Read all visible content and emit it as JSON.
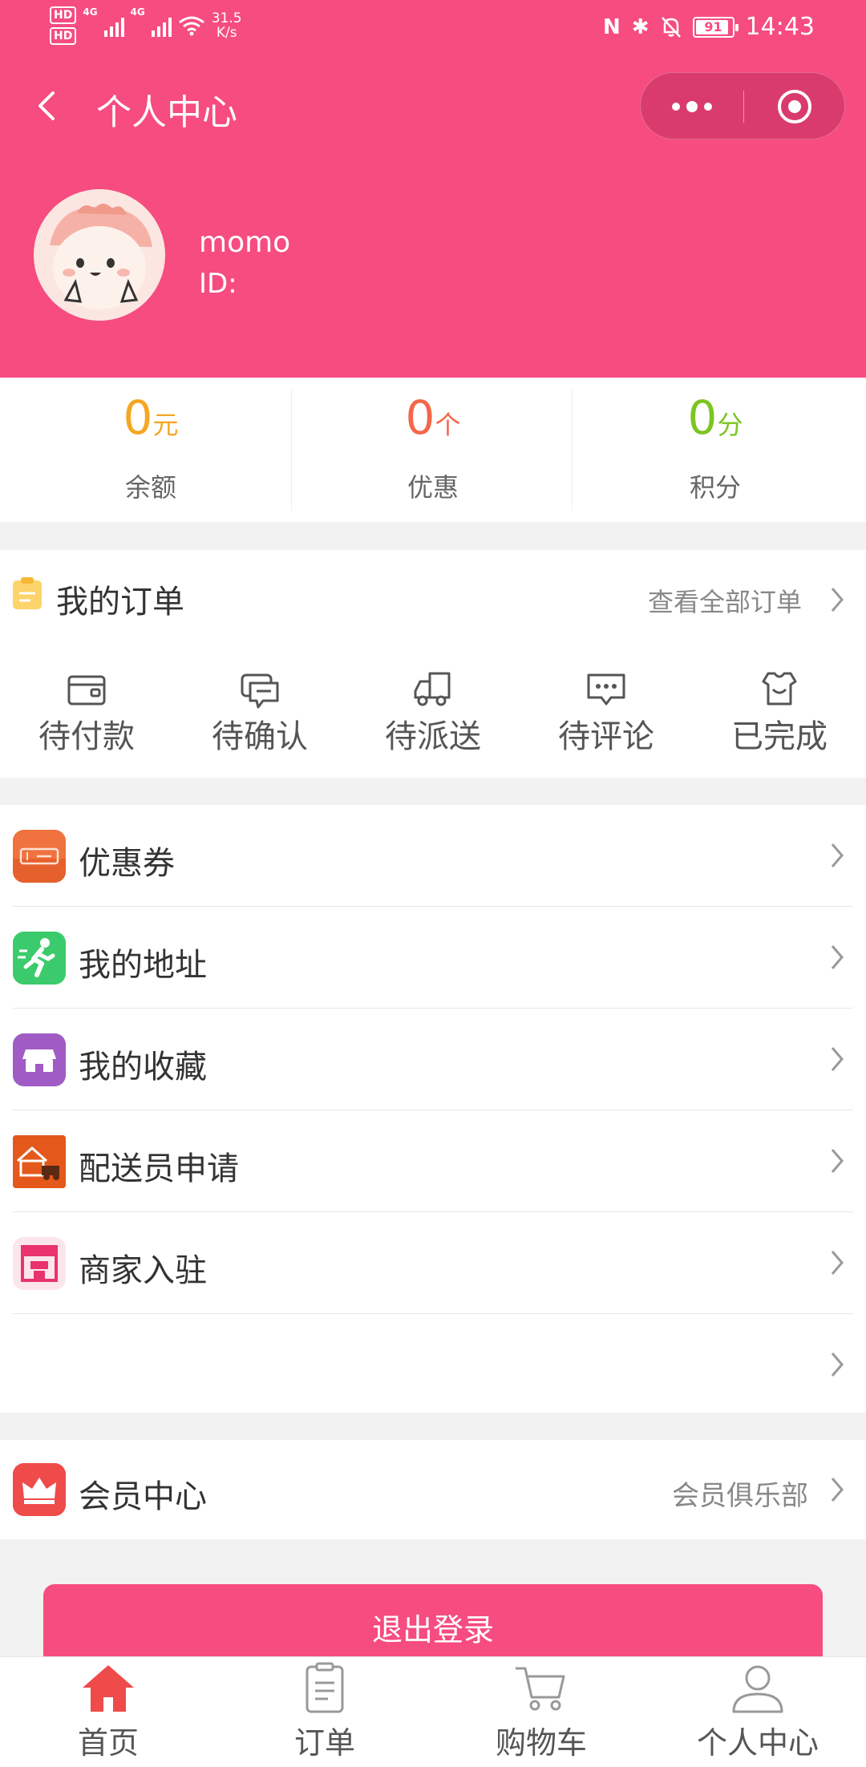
{
  "status_bar": {
    "hd_top": "HD",
    "hd_bottom": "HD",
    "signal_1": "4G",
    "signal_2": "4G",
    "net_speed_value": "31.5",
    "net_speed_unit": "K/s",
    "nfc": "N",
    "bluetooth": "✱",
    "battery_level": "91",
    "time": "14:43"
  },
  "nav": {
    "title": "个人中心"
  },
  "profile": {
    "username": "momo",
    "id_label": "ID:"
  },
  "stats": [
    {
      "value": "0",
      "unit": "元",
      "label": "余额",
      "color": "#f5a623"
    },
    {
      "value": "0",
      "unit": "个",
      "label": "优惠",
      "color": "#f4664a"
    },
    {
      "value": "0",
      "unit": "分",
      "label": "积分",
      "color": "#7cc522"
    }
  ],
  "orders": {
    "title": "我的订单",
    "view_all": "查看全部订单",
    "tabs": [
      {
        "label": "待付款",
        "icon": "wallet-icon"
      },
      {
        "label": "待确认",
        "icon": "confirm-chat-icon"
      },
      {
        "label": "待派送",
        "icon": "delivery-truck-icon"
      },
      {
        "label": "待评论",
        "icon": "comment-icon"
      },
      {
        "label": "已完成",
        "icon": "completed-shirt-icon"
      }
    ]
  },
  "menu": [
    {
      "label": "优惠券",
      "icon": "coupon-icon",
      "color": "#f0733f"
    },
    {
      "label": "我的地址",
      "icon": "runner-icon",
      "color": "#3ccb6c"
    },
    {
      "label": "我的收藏",
      "icon": "store-icon",
      "color": "#a15bc4"
    },
    {
      "label": "配送员申请",
      "icon": "courier-house-icon",
      "color": "#e4581c"
    },
    {
      "label": "商家入驻",
      "icon": "shop-icon",
      "color": "#e8336d"
    },
    {
      "label": "",
      "icon": ""
    }
  ],
  "vip": {
    "label": "会员中心",
    "sub": "会员俱乐部",
    "icon": "crown-icon",
    "color": "#ef4b4b"
  },
  "logout_label": "退出登录",
  "tabbar": [
    {
      "label": "首页",
      "icon": "home-icon",
      "active": true,
      "color": "#ef4b4b"
    },
    {
      "label": "订单",
      "icon": "clipboard-icon",
      "active": false
    },
    {
      "label": "购物车",
      "icon": "cart-icon",
      "active": false
    },
    {
      "label": "个人中心",
      "icon": "user-icon",
      "active": false
    }
  ],
  "theme": {
    "primary": "#f64c80"
  }
}
